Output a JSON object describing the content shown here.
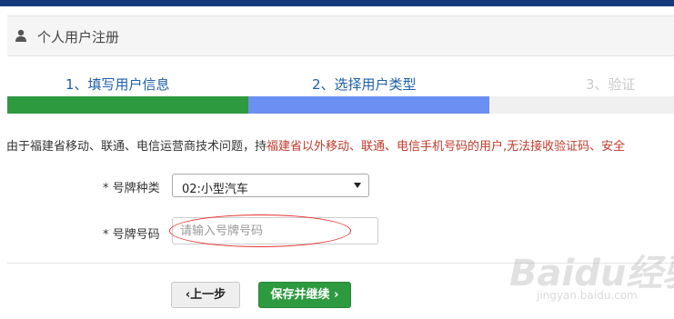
{
  "panel": {
    "title": "个人用户注册"
  },
  "steps": [
    {
      "label": "1、填写用户信息",
      "state": "done"
    },
    {
      "label": "2、选择用户类型",
      "state": "active"
    },
    {
      "label": "3、验证",
      "state": "pending"
    }
  ],
  "colors": {
    "top_bar": "#143a7b",
    "step_done": "#2e9a40",
    "step_active": "#6b8ff2",
    "notice_red": "#c0392b"
  },
  "notice": {
    "part1": "由于福建省移动、联通、电信运营商技术问题，持",
    "part2": "福建省以外移动、联通、电信手机号码的用户,",
    "part3": "无法接收验证码、安全"
  },
  "form": {
    "plate_type_label": "* 号牌种类",
    "plate_type_value": "02:小型汽车",
    "plate_no_label": "* 号牌号码",
    "plate_no_placeholder": "请输入号牌号码"
  },
  "buttons": {
    "prev": "上一步",
    "next": "保存并继续"
  },
  "watermark": {
    "brand": "Baidu经验",
    "url": "jingyan.baidu.com"
  }
}
